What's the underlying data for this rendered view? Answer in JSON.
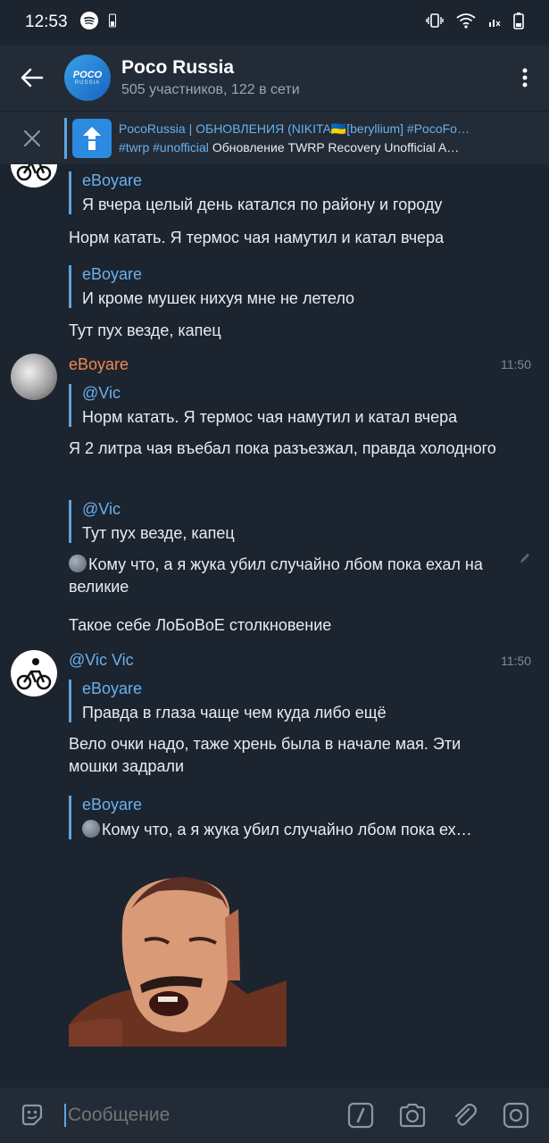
{
  "status_bar": {
    "time": "12:53"
  },
  "header": {
    "avatar_line1": "POCO",
    "avatar_line2": "RUSSIA",
    "title": "Poco Russia",
    "subtitle": "505 участников, 122 в сети"
  },
  "pinned": {
    "title": "PocoRussia | ОБНОВЛЕНИЯ (NIKITA🇺🇦[beryllium] #PocoFo…",
    "tags": "#twrp #unofficial",
    "body": "Обновление TWRP Recovery Unofficial A…"
  },
  "messages": {
    "m1_reply_name": "eBoyare",
    "m1_reply_text": "Я вчера целый день катался по району и городу",
    "m1_text": "Норм катать. Я термос чая намутил и катал вчера",
    "m2_reply_name": "eBoyare",
    "m2_reply_text": "И кроме мушек нихуя мне не летело",
    "m2_text": "Тут пух везде, капец",
    "g2_sender": "eBoyare",
    "g2_time": "11:50",
    "m3_reply_name": "@Vic",
    "m3_reply_text": "Норм катать. Я термос чая намутил и катал вчера",
    "m3_text": "Я 2 литра чая въебал пока разъезжал, правда холодного",
    "m4_reply_name": "@Vic",
    "m4_reply_text": "Тут пух везде, капец",
    "m4_text": "Кому что, а я жука убил случайно лбом пока ехал на великие",
    "m5_text": "Такое себе ЛоБоВоЕ столкновение",
    "g3_sender": "@Vic Vic",
    "g3_time": "11:50",
    "m6_reply_name": "eBoyare",
    "m6_reply_text": "Правда в глаза чаще чем куда либо ещё",
    "m6_text": "Вело очки надо, таже хрень была в начале мая. Эти мошки задрали",
    "m7_reply_name": "eBoyare",
    "m7_reply_text": "Кому что, а я жука убил случайно лбом пока ех…"
  },
  "input": {
    "placeholder": "Сообщение"
  },
  "colors": {
    "background": "#1c242f",
    "bar": "#222b36",
    "accent": "#5ea4e0",
    "orange_name": "#f08a4b"
  }
}
